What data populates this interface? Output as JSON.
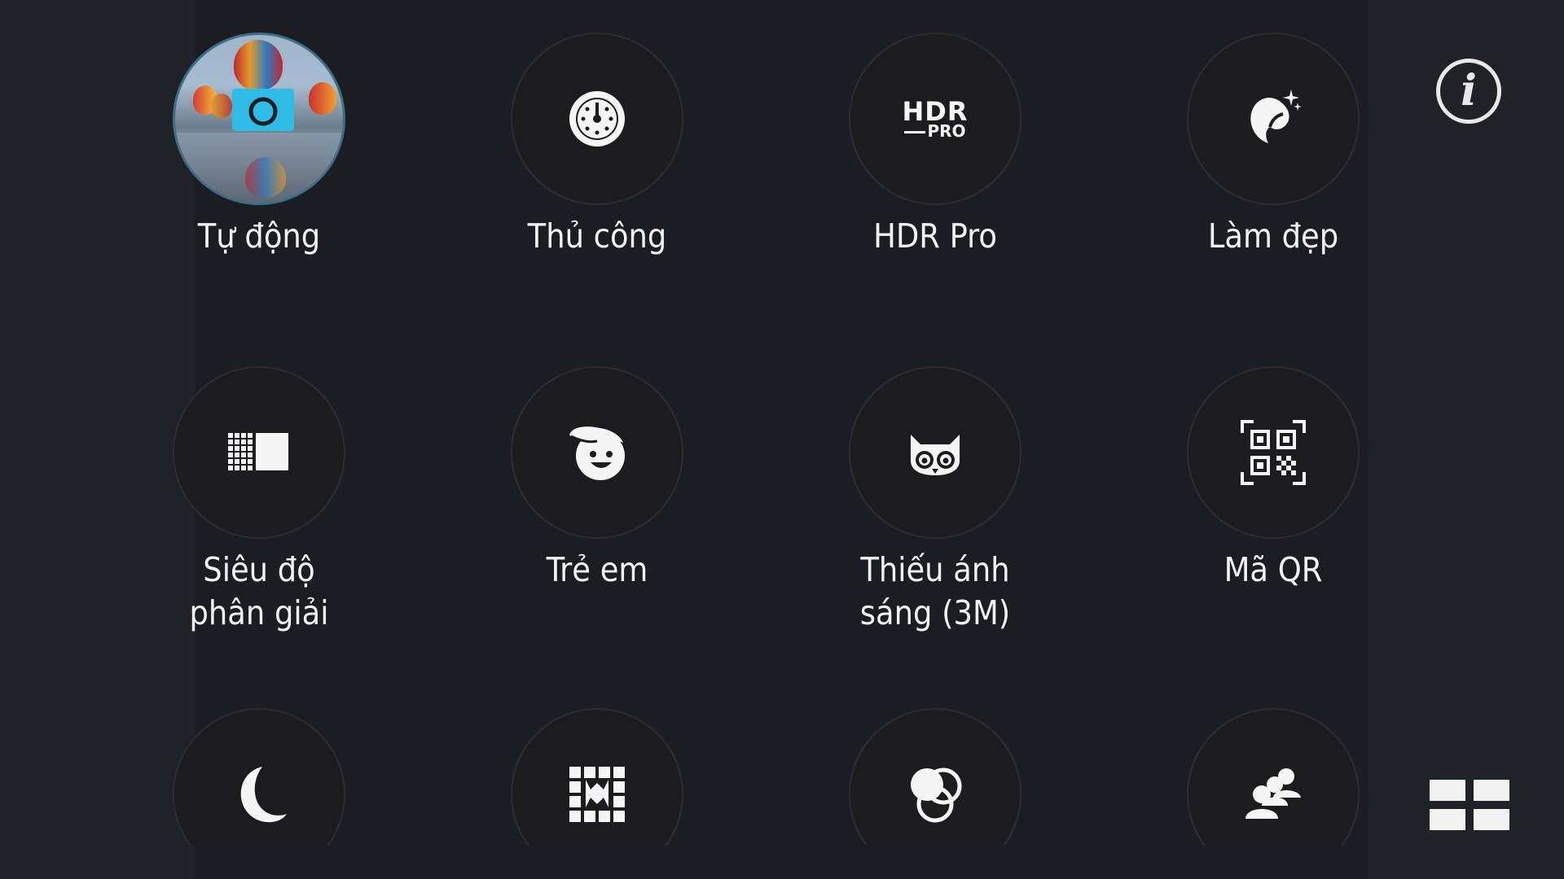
{
  "modes": [
    {
      "label": "Tự động",
      "icon": "auto-camera-icon",
      "active": true
    },
    {
      "label": "Thủ công",
      "icon": "manual-dial-icon"
    },
    {
      "label": "HDR Pro",
      "icon": "hdr-pro-icon",
      "icon_text": "HDR",
      "icon_subtext": "PRO"
    },
    {
      "label": "Làm đẹp",
      "icon": "beautify-icon"
    },
    {
      "label": "Siêu độ\nphân giải",
      "icon": "super-resolution-icon"
    },
    {
      "label": "Trẻ em",
      "icon": "children-face-icon"
    },
    {
      "label": "Thiếu ánh\nsáng (3M)",
      "icon": "low-light-owl-icon"
    },
    {
      "label": "Mã QR",
      "icon": "qr-code-icon"
    },
    {
      "label": "",
      "icon": "night-moon-icon"
    },
    {
      "label": "",
      "icon": "frame-collage-icon"
    },
    {
      "label": "",
      "icon": "filter-circles-icon"
    },
    {
      "label": "",
      "icon": "group-people-icon"
    }
  ],
  "side": {
    "info_icon": "info-icon",
    "info_glyph": "i",
    "grid_icon": "grid-layout-icon"
  },
  "colors": {
    "background": "#202227",
    "panel": "#1b1d22",
    "accent": "#2ebbe6",
    "text": "#f2f2f2"
  }
}
